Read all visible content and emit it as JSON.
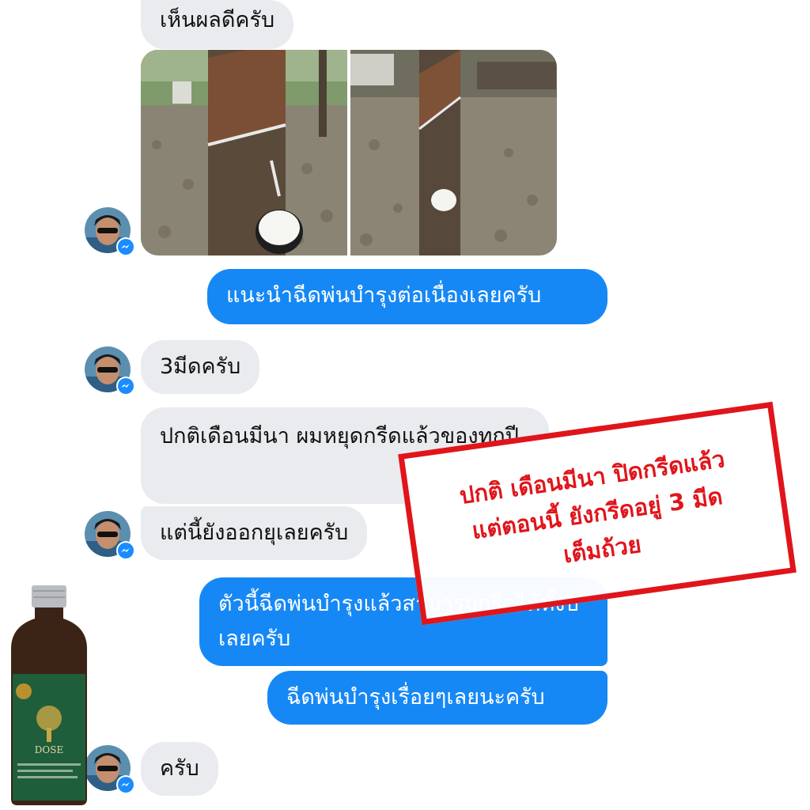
{
  "messages": {
    "m1": "เห็นผลดีครับ",
    "m2": "แนะนำฉีดพ่นบำรุงต่อเนื่องเลยครับ",
    "m3": "3มีดครับ",
    "m4": "ปกติเดือนมีนา ผมหยุดกรีดแล้วของทุกปี",
    "m5": "แต่นี้ยังออกยุเลยครับ",
    "m6": "ตัวนี้ฉีดพ่นบำรุงแล้วสามารถกรีดได้ทั้งปีเลยครับ",
    "m7": "ฉีดพ่นบำรุงเรื่อยๆเลยนะครับ",
    "m8": "ครับ"
  },
  "callout": {
    "line1": "ปกติ เดือนมีนา ปิดกรีดแล้ว",
    "line2": "แต่ตอนนี้ ยังกรีดอยู่ 3 มีด",
    "line3": "เต็มถ้วย"
  },
  "product": {
    "brand": "DOSE"
  },
  "colors": {
    "incoming_bubble": "#eaebef",
    "outgoing_bubble": "#1688f5",
    "callout_red": "#e0151b",
    "messenger_badge": "#1a8cff"
  },
  "icons": {
    "avatar_badge": "messenger-icon"
  }
}
